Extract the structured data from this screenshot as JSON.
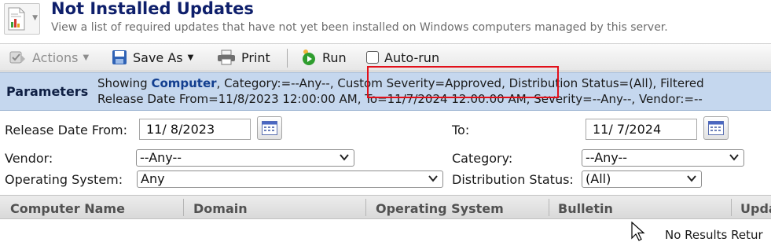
{
  "header": {
    "title": "Not Installed Updates",
    "description": "View a list of required updates that have not yet been installed on Windows computers managed by this server.",
    "icon": "report-icon"
  },
  "toolbar": {
    "actions_label": "Actions",
    "save_as_label": "Save As",
    "print_label": "Print",
    "run_label": "Run",
    "autorun_label": "Auto-run",
    "autorun_checked": false,
    "colors": {
      "save_icon": "#2f62b5",
      "run_icon": "#2e9d2e"
    }
  },
  "parameters": {
    "label": "Parameters",
    "line1_prefix": "Showing ",
    "line1_entity": "Computer",
    "line1_rest": ", Category:=--Any--, Custom Severity=Approved, Distribution Status=(All), Filtered",
    "line2": "Release Date From=11/8/2023 12:00:00 AM, To=11/7/2024 12:00:00 AM, Severity=--Any--, Vendor:=--",
    "highlighted_text": "Custom Severity=Approved,",
    "highlight_color": "#e2101a"
  },
  "filters": {
    "release_from_label": "Release Date From:",
    "release_from_value": "11/ 8/2023",
    "to_label": "To:",
    "to_value": "11/ 7/2024",
    "vendor_label": "Vendor:",
    "vendor_value": "--Any--",
    "category_label": "Category:",
    "category_value": "--Any--",
    "os_label": "Operating System:",
    "os_value": "Any",
    "distribution_label": "Distribution Status:",
    "distribution_value": "(All)"
  },
  "grid": {
    "columns": [
      "Computer Name",
      "Domain",
      "Operating System",
      "Bulletin",
      "Upda"
    ],
    "empty_message": "No Results Retur"
  }
}
